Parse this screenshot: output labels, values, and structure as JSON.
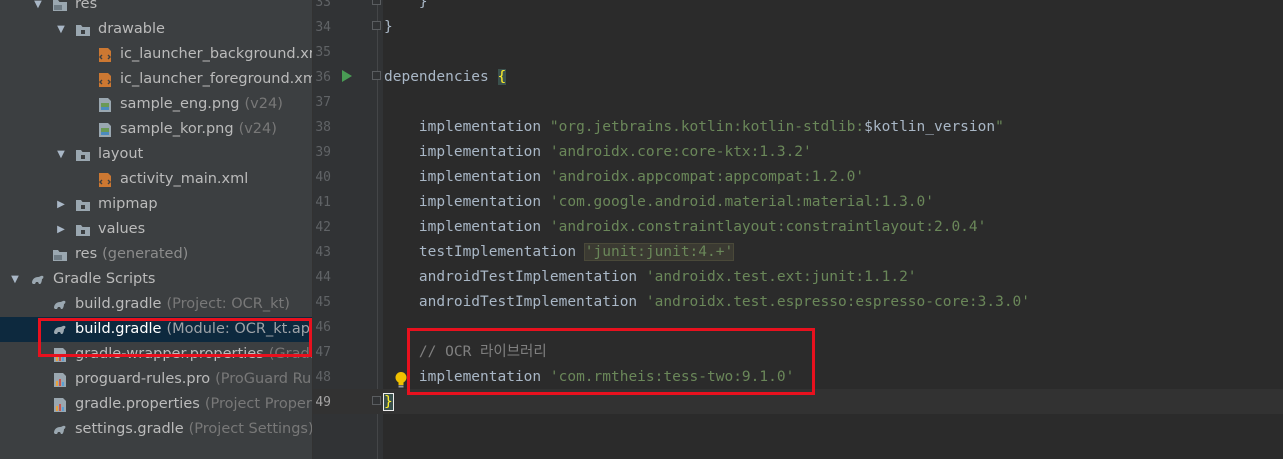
{
  "project_tree": {
    "items": [
      {
        "label": "res",
        "hint": "",
        "indent": 1,
        "expanded": true,
        "icon": "res-folder-icon"
      },
      {
        "label": "drawable",
        "hint": "",
        "indent": 2,
        "expanded": true,
        "icon": "folder-icon"
      },
      {
        "label": "ic_launcher_background.xml",
        "hint": "",
        "indent": 3,
        "icon": "xml-file-icon"
      },
      {
        "label": "ic_launcher_foreground.xml",
        "hint": "",
        "indent": 3,
        "icon": "xml-file-icon"
      },
      {
        "label": "sample_eng.png",
        "hint": "(v24)",
        "indent": 3,
        "icon": "image-file-icon"
      },
      {
        "label": "sample_kor.png",
        "hint": "(v24)",
        "indent": 3,
        "icon": "image-file-icon"
      },
      {
        "label": "layout",
        "hint": "",
        "indent": 2,
        "expanded": true,
        "icon": "folder-icon"
      },
      {
        "label": "activity_main.xml",
        "hint": "",
        "indent": 3,
        "icon": "xml-file-icon"
      },
      {
        "label": "mipmap",
        "hint": "",
        "indent": 2,
        "expanded": false,
        "icon": "folder-icon"
      },
      {
        "label": "values",
        "hint": "",
        "indent": 2,
        "expanded": false,
        "icon": "folder-icon"
      },
      {
        "label": "res",
        "hint": "(generated)",
        "indent": 1,
        "icon": "res-folder-icon"
      },
      {
        "label": "Gradle Scripts",
        "hint": "",
        "indent": 0,
        "expanded": true,
        "icon": "gradle-icon"
      },
      {
        "label": "build.gradle",
        "hint": "(Project: OCR_kt)",
        "indent": 1,
        "icon": "gradle-icon"
      },
      {
        "label": "build.gradle",
        "hint": "(Module: OCR_kt.app)",
        "indent": 1,
        "icon": "gradle-icon",
        "selected": true
      },
      {
        "label": "gradle-wrapper.properties",
        "hint": "(Gradle Version)",
        "indent": 1,
        "icon": "properties-file-icon"
      },
      {
        "label": "proguard-rules.pro",
        "hint": "(ProGuard Rules for OCR_kt.app)",
        "indent": 1,
        "icon": "properties-file-icon"
      },
      {
        "label": "gradle.properties",
        "hint": "(Project Properties)",
        "indent": 1,
        "icon": "properties-file-icon"
      },
      {
        "label": "settings.gradle",
        "hint": "(Project Settings)",
        "indent": 1,
        "icon": "gradle-icon"
      }
    ]
  },
  "editor": {
    "line_numbers": [
      "33",
      "34",
      "35",
      "36",
      "37",
      "38",
      "39",
      "40",
      "41",
      "42",
      "43",
      "44",
      "45",
      "46",
      "47",
      "48",
      "49"
    ],
    "current_line": "49",
    "lines": {
      "l33": "    }",
      "l34": "}",
      "l36_kw": "dependencies ",
      "l36_brace": "{",
      "l38_fn": "    implementation ",
      "l38_s1": "\"org.jetbrains.kotlin:kotlin-stdlib:",
      "l38_tpl": "$kotlin_version",
      "l38_s2": "\"",
      "l39_fn": "    implementation ",
      "l39_s": "'androidx.core:core-ktx:1.3.2'",
      "l40_fn": "    implementation ",
      "l40_s": "'androidx.appcompat:appcompat:1.2.0'",
      "l41_fn": "    implementation ",
      "l41_s": "'com.google.android.material:material:1.3.0'",
      "l42_fn": "    implementation ",
      "l42_s": "'androidx.constraintlayout:constraintlayout:2.0.4'",
      "l43_fn": "    testImplementation ",
      "l43_s": "'junit:junit:4.+'",
      "l44_fn": "    androidTestImplementation ",
      "l44_s": "'androidx.test.ext:junit:1.1.2'",
      "l45_fn": "    androidTestImplementation ",
      "l45_s": "'androidx.test.espresso:espresso-core:3.3.0'",
      "l47_comment": "    // OCR 라이브러리",
      "l48_fn": "    implementation ",
      "l48_s": "'com.rmtheis:tess-two:9.1.0'",
      "l49_brace": "}"
    }
  },
  "colors": {
    "sidebar_bg": "#3c3f41",
    "editor_bg": "#2b2b2b",
    "gutter_bg": "#313335",
    "selection_bg": "#0d293e",
    "string": "#6a8759",
    "comment": "#808080",
    "highlight_box": "#e8111e"
  }
}
